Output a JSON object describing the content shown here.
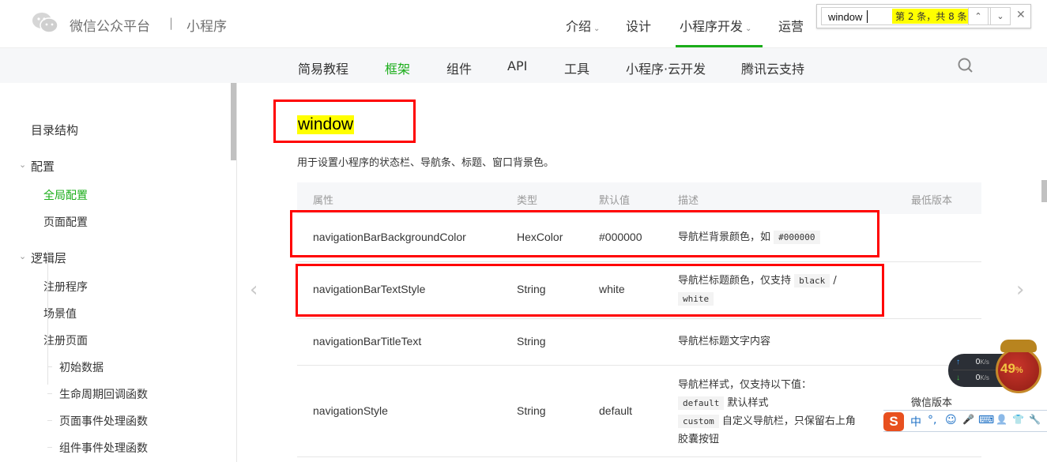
{
  "colors": {
    "accent": "#1aad19",
    "highlight": "#ffff00",
    "annotation": "#ff0000"
  },
  "header": {
    "brand": "微信公众平台",
    "separator": "|",
    "product": "小程序",
    "nav": [
      {
        "label": "介绍",
        "has_dropdown": true
      },
      {
        "label": "设计",
        "has_dropdown": false
      },
      {
        "label": "小程序开发",
        "has_dropdown": true,
        "active": true
      },
      {
        "label": "运营",
        "has_dropdown": false
      }
    ],
    "chevron": "⌄"
  },
  "find_bar": {
    "query": "window",
    "match_status": "第 2 条，共 8 条",
    "prev_icon": "⌃",
    "next_icon": "⌄",
    "close_icon": "✕"
  },
  "subnav": {
    "items": [
      {
        "label": "简易教程"
      },
      {
        "label": "框架",
        "active": true
      },
      {
        "label": "组件"
      },
      {
        "label": "API"
      },
      {
        "label": "工具"
      },
      {
        "label": "小程序·云开发"
      },
      {
        "label": "腾讯云支持"
      }
    ]
  },
  "sidebar": {
    "items": [
      {
        "label": "目录结构",
        "level": 0
      },
      {
        "label": "配置",
        "level": 0,
        "expanded": true
      },
      {
        "label": "全局配置",
        "level": 1,
        "active": true
      },
      {
        "label": "页面配置",
        "level": 1
      },
      {
        "label": "逻辑层",
        "level": 0,
        "expanded": true
      },
      {
        "label": "注册程序",
        "level": 1
      },
      {
        "label": "场景值",
        "level": 1
      },
      {
        "label": "注册页面",
        "level": 1
      },
      {
        "label": "初始数据",
        "level": 2
      },
      {
        "label": "生命周期回调函数",
        "level": 2
      },
      {
        "label": "页面事件处理函数",
        "level": 2
      },
      {
        "label": "组件事件处理函数",
        "level": 2
      }
    ]
  },
  "content": {
    "title": "window",
    "description": "用于设置小程序的状态栏、导航条、标题、窗口背景色。",
    "table": {
      "headers": [
        "属性",
        "类型",
        "默认值",
        "描述",
        "最低版本"
      ],
      "rows": [
        {
          "property": "navigationBarBackgroundColor",
          "type": "HexColor",
          "default": "#000000",
          "desc_text": "导航栏背景颜色，如",
          "desc_code": "#000000",
          "min_version": ""
        },
        {
          "property": "navigationBarTextStyle",
          "type": "String",
          "default": "white",
          "desc_text": "导航栏标题颜色，仅支持",
          "desc_code1": "black",
          "desc_sep": "/",
          "desc_code2": "white",
          "min_version": ""
        },
        {
          "property": "navigationBarTitleText",
          "type": "String",
          "default": "",
          "desc_text": "导航栏标题文字内容",
          "min_version": ""
        },
        {
          "property": "navigationStyle",
          "type": "String",
          "default": "default",
          "desc_text": "导航栏样式，仅支持以下值：",
          "desc_opt1_code": "default",
          "desc_opt1_text": "默认样式",
          "desc_opt2_code": "custom",
          "desc_opt2_text": "自定义导航栏，只保留右上角",
          "desc_opt2_text_cont": "胶囊按钮",
          "min_version": "微信版本"
        }
      ]
    },
    "prev_arrow": "‹",
    "next_arrow": "›"
  },
  "overlays": {
    "net_speed": {
      "upload": "0",
      "download": "0",
      "unit": "K/s",
      "up_icon": "↑",
      "down_icon": "↓"
    },
    "memory_orb": {
      "value": "49",
      "unit": "%"
    },
    "ime_toolbar": {
      "logo": "S",
      "mode": "中",
      "punct": "°,",
      "emoji": "☺",
      "voice": "🎤",
      "keyboard": "⌨",
      "user": "👤",
      "skin": "👕",
      "tools": "🔧"
    }
  }
}
